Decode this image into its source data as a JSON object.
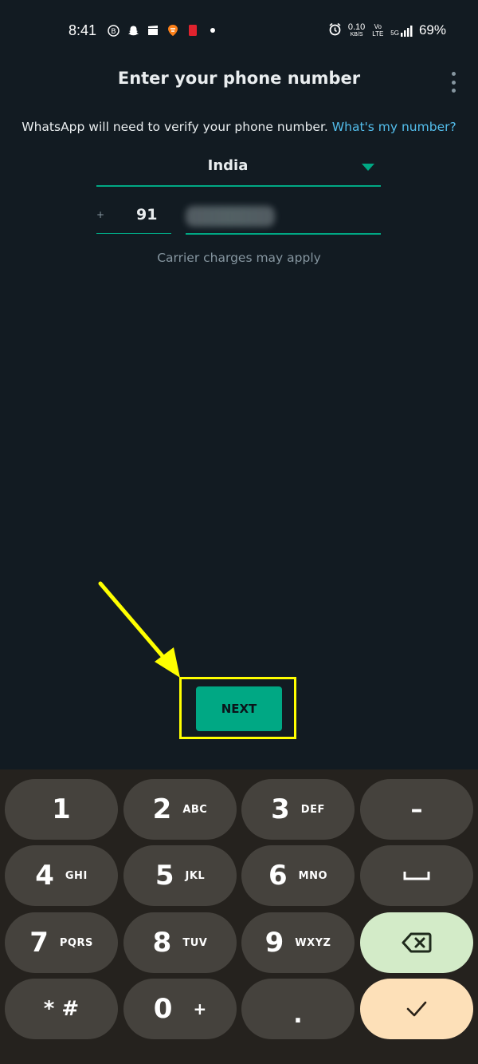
{
  "status_bar": {
    "time": "8:41",
    "network_speed_value": "0.10",
    "network_speed_unit": "KB/S",
    "volte_label": "Vo LTE",
    "signal_label": "5G",
    "battery_percent": "69%"
  },
  "header": {
    "title": "Enter your phone number"
  },
  "verify": {
    "text": "WhatsApp will need to verify your phone number.",
    "link": "What's my number?"
  },
  "country": {
    "name": "India"
  },
  "phone": {
    "plus": "+",
    "country_code": "91"
  },
  "carrier_note": "Carrier charges may apply",
  "next_label": "NEXT",
  "keypad": {
    "k1": {
      "digit": "1",
      "letters": ""
    },
    "k2": {
      "digit": "2",
      "letters": "ABC"
    },
    "k3": {
      "digit": "3",
      "letters": "DEF"
    },
    "k4": {
      "digit": "4",
      "letters": "GHI"
    },
    "k5": {
      "digit": "5",
      "letters": "JKL"
    },
    "k6": {
      "digit": "6",
      "letters": "MNO"
    },
    "k7": {
      "digit": "7",
      "letters": "PQRS"
    },
    "k8": {
      "digit": "8",
      "letters": "TUV"
    },
    "k9": {
      "digit": "9",
      "letters": "WXYZ"
    },
    "k0": {
      "digit": "0",
      "letters": "+"
    },
    "star_hash": "* #",
    "dot": ".",
    "dash": "–"
  },
  "colors": {
    "background": "#121b22",
    "accent": "#00a884",
    "link": "#53bdeb",
    "highlight": "#ffff00"
  }
}
